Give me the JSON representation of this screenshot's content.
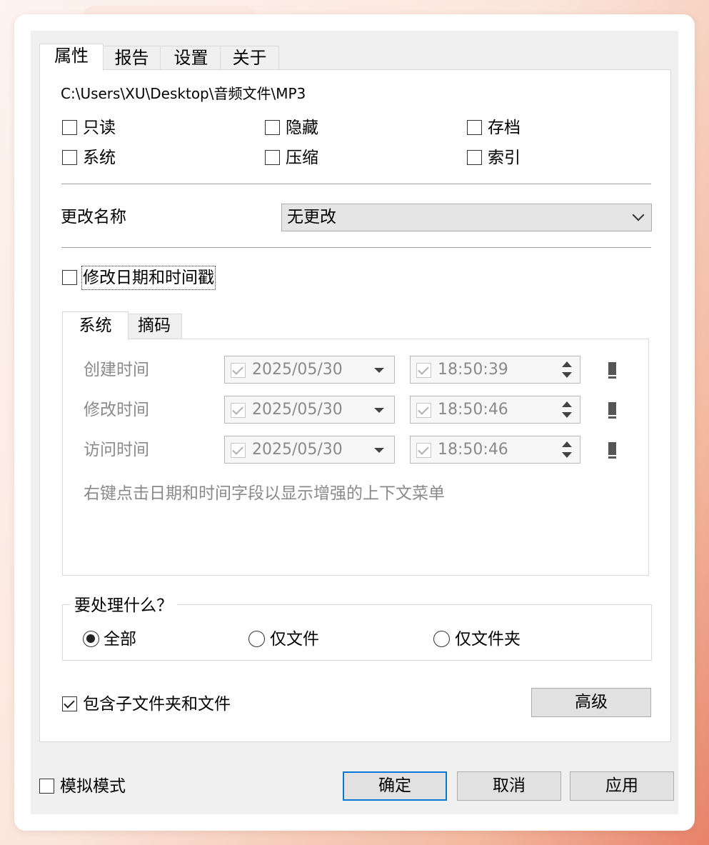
{
  "tabs": [
    "属性",
    "报告",
    "设置",
    "关于"
  ],
  "path": "C:\\Users\\XU\\Desktop\\音频文件\\MP3",
  "attributes": [
    {
      "label": "只读",
      "checked": false
    },
    {
      "label": "隐藏",
      "checked": false
    },
    {
      "label": "存档",
      "checked": false
    },
    {
      "label": "系统",
      "checked": false
    },
    {
      "label": "压缩",
      "checked": false
    },
    {
      "label": "索引",
      "checked": false
    }
  ],
  "rename": {
    "label": "更改名称",
    "value": "无更改"
  },
  "modify_timestamps": {
    "label": "修改日期和时间戳",
    "checked": false
  },
  "inner_tabs": [
    "系统",
    "摘码"
  ],
  "timestamps": [
    {
      "label": "创建时间",
      "date": "2025/05/30",
      "time": "18:50:39"
    },
    {
      "label": "修改时间",
      "date": "2025/05/30",
      "time": "18:50:46"
    },
    {
      "label": "访问时间",
      "date": "2025/05/30",
      "time": "18:50:46"
    }
  ],
  "hint": "右键点击日期和时间字段以显示增强的上下文菜单",
  "process": {
    "title": "要处理什么？",
    "options": [
      "全部",
      "仅文件",
      "仅文件夹"
    ],
    "selected": "全部"
  },
  "include_subfolders": {
    "label": "包含子文件夹和文件",
    "checked": true
  },
  "advanced_label": "高级",
  "simulate": {
    "label": "模拟模式",
    "checked": false
  },
  "buttons": {
    "ok": "确定",
    "cancel": "取消",
    "apply": "应用"
  }
}
